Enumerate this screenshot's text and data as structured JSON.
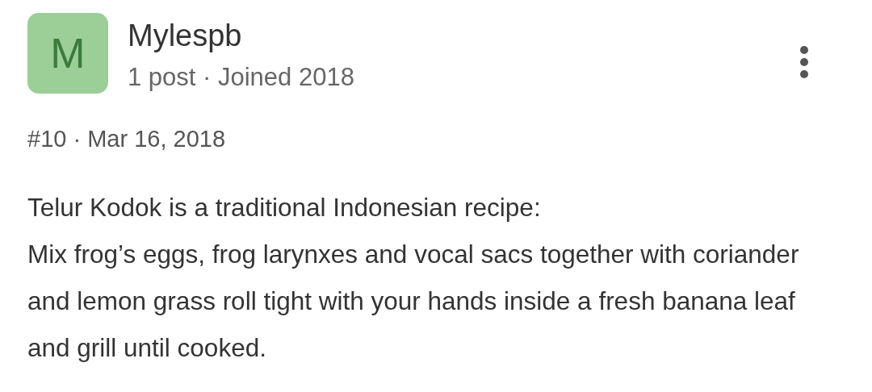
{
  "post": {
    "avatar_letter": "M",
    "author": "Mylespb",
    "author_meta": "1 post · Joined 2018",
    "post_meta": "#10 · Mar 16, 2018",
    "body": [
      "Telur Kodok is a traditional Indonesian recipe:",
      "Mix frog’s eggs, frog larynxes and vocal sacs together with coriander and lemon grass roll tight with your hands inside a fresh banana leaf and grill until cooked."
    ]
  }
}
